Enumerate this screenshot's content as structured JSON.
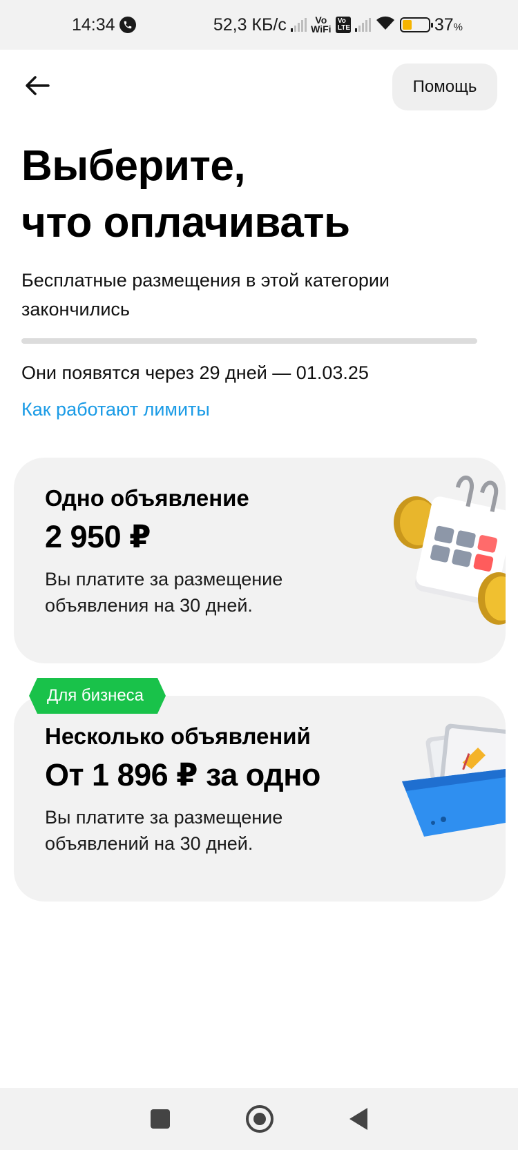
{
  "status_bar": {
    "time": "14:34",
    "network_speed": "52,3 КБ/с",
    "vowifi_label": "Vo WiFi",
    "volte_label": "Vo LTE",
    "battery_percent": "37",
    "battery_symbol": "%",
    "battery_level": 0.37,
    "battery_color": "#f5b400"
  },
  "header": {
    "back_icon": "arrow-left-icon",
    "help_label": "Помощь"
  },
  "title_lines": [
    "Выберите,",
    "что оплачивать"
  ],
  "subtitle": "Бесплатные размещения в этой категории закончились",
  "limit_progress": 0.0,
  "renewal_text": "Они появятся через 29 дней — 01.03.25",
  "limits_link": "Как работают лимиты",
  "cards": [
    {
      "title": "Одно объявление",
      "price": "2 950 ₽",
      "description": "Вы платите за размещение объявления на 30 дней.",
      "illustration": "calendar-coins-icon"
    },
    {
      "badge": "Для бизнеса",
      "title": "Несколько объявлений",
      "price": "От 1 896 ₽ за одно",
      "description": "Вы платите за размещение объявлений на 30 дней.",
      "illustration": "basket-listings-icon"
    }
  ],
  "colors": {
    "accent_link": "#1a9be6",
    "badge_green": "#19c24a",
    "card_bg": "#f2f2f2"
  },
  "nav_bar": [
    "recent-apps-icon",
    "home-icon",
    "back-icon"
  ]
}
